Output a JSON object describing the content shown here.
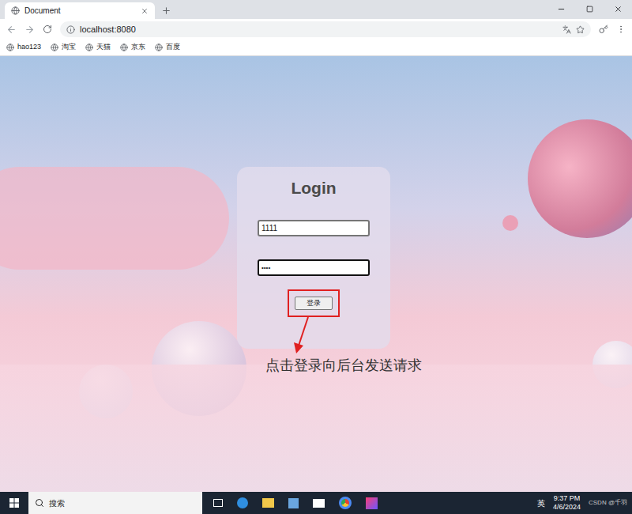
{
  "window": {
    "tab_title": "Document",
    "url": "localhost:8080"
  },
  "bookmarks": [
    "hao123",
    "淘宝",
    "天猫",
    "京东",
    "百度"
  ],
  "login": {
    "title": "Login",
    "username": "1111",
    "password": "••••",
    "button": "登录",
    "highlighted": true
  },
  "annotation": "点击登录向后台发送请求",
  "taskbar": {
    "search_placeholder": "搜索",
    "ime": "英",
    "time": "9:37 PM",
    "date": "4/6/2024",
    "watermark": "CSDN @千羽"
  }
}
